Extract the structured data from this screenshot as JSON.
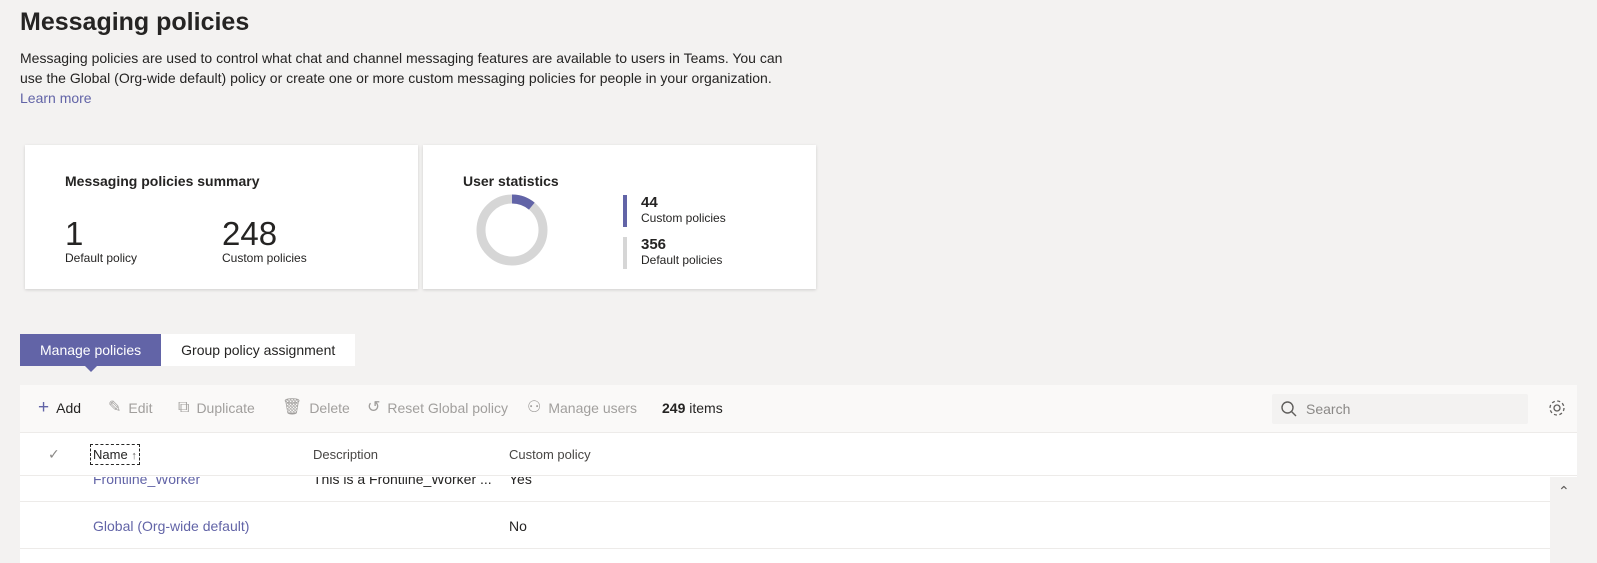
{
  "page": {
    "title": "Messaging policies",
    "intro": "Messaging policies are used to control what chat and channel messaging features are available to users in Teams. You can use the Global (Org-wide default) policy or create one or more custom messaging policies for people in your organization.",
    "learn_more": "Learn more"
  },
  "summary": {
    "title": "Messaging policies summary",
    "default_count": "1",
    "default_label": "Default policy",
    "custom_count": "248",
    "custom_label": "Custom policies"
  },
  "user_stats": {
    "title": "User statistics",
    "custom_value": "44",
    "custom_label": "Custom policies",
    "default_value": "356",
    "default_label": "Default policies",
    "colors": {
      "custom": "#6264a7",
      "default": "#d6d6d6"
    },
    "custom_fraction": 0.11
  },
  "tabs": [
    {
      "label": "Manage policies",
      "active": true
    },
    {
      "label": "Group policy assignment",
      "active": false
    }
  ],
  "toolbar": {
    "add": "Add",
    "edit": "Edit",
    "duplicate": "Duplicate",
    "delete": "Delete",
    "reset": "Reset Global policy",
    "manage_users": "Manage users",
    "count_num": "249",
    "count_label": "items",
    "search_placeholder": "Search"
  },
  "table": {
    "headers": {
      "name": "Name",
      "description": "Description",
      "custom": "Custom policy"
    },
    "rows": [
      {
        "name": "Frontline_Worker",
        "description": "This is a Frontline_Worker ...",
        "custom": "Yes"
      },
      {
        "name": "Global (Org-wide default)",
        "description": "",
        "custom": "No"
      }
    ]
  }
}
